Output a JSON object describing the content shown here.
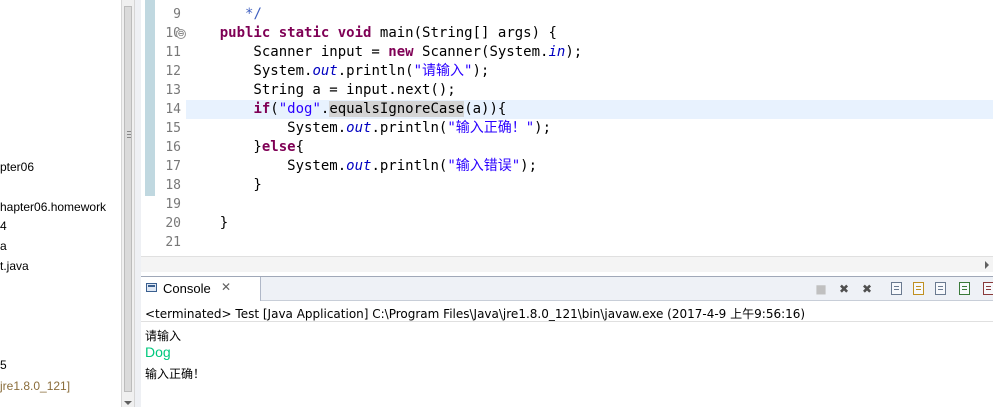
{
  "explorer": {
    "items": [
      {
        "label": "pter06",
        "kind": "package"
      },
      {
        "label": "hapter06.homework",
        "kind": "package"
      },
      {
        "label": "4",
        "kind": "file"
      },
      {
        "label": "a",
        "kind": "file"
      },
      {
        "label": "t.java",
        "kind": "file"
      },
      {
        "label": "5",
        "kind": "file"
      },
      {
        "label": "jre1.8.0_121]",
        "kind": "library"
      }
    ]
  },
  "editor": {
    "line_numbers": [
      "9",
      "10",
      "11",
      "12",
      "13",
      "14",
      "15",
      "16",
      "17",
      "18",
      "19",
      "20",
      "21"
    ],
    "lines": [
      {
        "tokens": [
          {
            "t": "       ",
            "c": ""
          },
          {
            "t": "*/",
            "c": "cm"
          }
        ]
      },
      {
        "tokens": [
          {
            "t": "    ",
            "c": ""
          },
          {
            "t": "public",
            "c": "kw"
          },
          {
            "t": " ",
            "c": ""
          },
          {
            "t": "static",
            "c": "kw"
          },
          {
            "t": " ",
            "c": ""
          },
          {
            "t": "void",
            "c": "kw"
          },
          {
            "t": " main(String[] args) {",
            "c": ""
          }
        ]
      },
      {
        "tokens": [
          {
            "t": "        Scanner input = ",
            "c": ""
          },
          {
            "t": "new",
            "c": "kw"
          },
          {
            "t": " Scanner(System.",
            "c": ""
          },
          {
            "t": "in",
            "c": "st"
          },
          {
            "t": ");",
            "c": ""
          }
        ]
      },
      {
        "tokens": [
          {
            "t": "        System.",
            "c": ""
          },
          {
            "t": "out",
            "c": "st"
          },
          {
            "t": ".println(",
            "c": ""
          },
          {
            "t": "\"请输入\"",
            "c": "str"
          },
          {
            "t": ");",
            "c": ""
          }
        ]
      },
      {
        "tokens": [
          {
            "t": "        String a = input.next();",
            "c": ""
          }
        ]
      },
      {
        "tokens": [
          {
            "t": "        ",
            "c": ""
          },
          {
            "t": "if",
            "c": "kw"
          },
          {
            "t": "(",
            "c": ""
          },
          {
            "t": "\"dog\"",
            "c": "str"
          },
          {
            "t": ".",
            "c": ""
          },
          {
            "t": "equalsIgnoreCase",
            "c": "occ"
          },
          {
            "t": "(a)){",
            "c": ""
          }
        ]
      },
      {
        "tokens": [
          {
            "t": "            System.",
            "c": ""
          },
          {
            "t": "out",
            "c": "st"
          },
          {
            "t": ".println(",
            "c": ""
          },
          {
            "t": "\"输入正确！\"",
            "c": "str"
          },
          {
            "t": ");",
            "c": ""
          }
        ]
      },
      {
        "tokens": [
          {
            "t": "        }",
            "c": ""
          },
          {
            "t": "else",
            "c": "kw"
          },
          {
            "t": "{",
            "c": ""
          }
        ]
      },
      {
        "tokens": [
          {
            "t": "            System.",
            "c": ""
          },
          {
            "t": "out",
            "c": "st"
          },
          {
            "t": ".println(",
            "c": ""
          },
          {
            "t": "\"输入错误\"",
            "c": "str"
          },
          {
            "t": ");",
            "c": ""
          }
        ]
      },
      {
        "tokens": [
          {
            "t": "        }",
            "c": ""
          }
        ]
      },
      {
        "tokens": [
          {
            "t": "",
            "c": ""
          }
        ]
      },
      {
        "tokens": [
          {
            "t": "    }",
            "c": ""
          }
        ]
      },
      {
        "tokens": [
          {
            "t": "",
            "c": ""
          }
        ]
      }
    ],
    "fold_symbol": "⊖"
  },
  "console": {
    "tab_label": "Console",
    "close_symbol": "✕",
    "status": "<terminated> Test [Java Application] C:\\Program Files\\Java\\jre1.8.0_121\\bin\\javaw.exe (2017-4-9 上午9:56:16)",
    "output_prompt": "请输入",
    "output_input": "Dog",
    "output_result": "输入正确！",
    "toolbar_symbols": {
      "stop": "■",
      "remove_launch": "✖",
      "remove_all": "✖"
    },
    "colors": {
      "stdin": "#00c87d",
      "stderr": "#ff0000"
    }
  }
}
